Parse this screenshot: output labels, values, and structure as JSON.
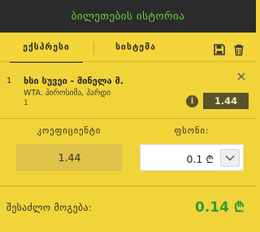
{
  "header": {
    "title": "ბილეთების ისტორია"
  },
  "tabs": [
    {
      "label": "ექსპრესი",
      "active": true
    },
    {
      "label": "სისტემა",
      "active": false
    }
  ],
  "toolbar": {
    "save_icon": "save-icon",
    "delete_icon": "trash-icon"
  },
  "bet": {
    "number": "1",
    "match": "ხსი სუვეი - მინელა მ.",
    "market": "WTA. პიროსიმა, პარდი",
    "selection": "1",
    "odds": "1.44"
  },
  "coefficient": {
    "label": "კოეფიციენტი",
    "value": "1.44"
  },
  "stake": {
    "label": "ფსონი:",
    "value": "0.1 ₾"
  },
  "winnings": {
    "label": "შესაძლო მოგება:",
    "value": "0.14 ₾"
  },
  "colors": {
    "accent_green": "#2f9a3c",
    "header_bg": "#2b2b2b",
    "panel_bg": "#f1d43a",
    "selection_red": "#d0151a"
  }
}
